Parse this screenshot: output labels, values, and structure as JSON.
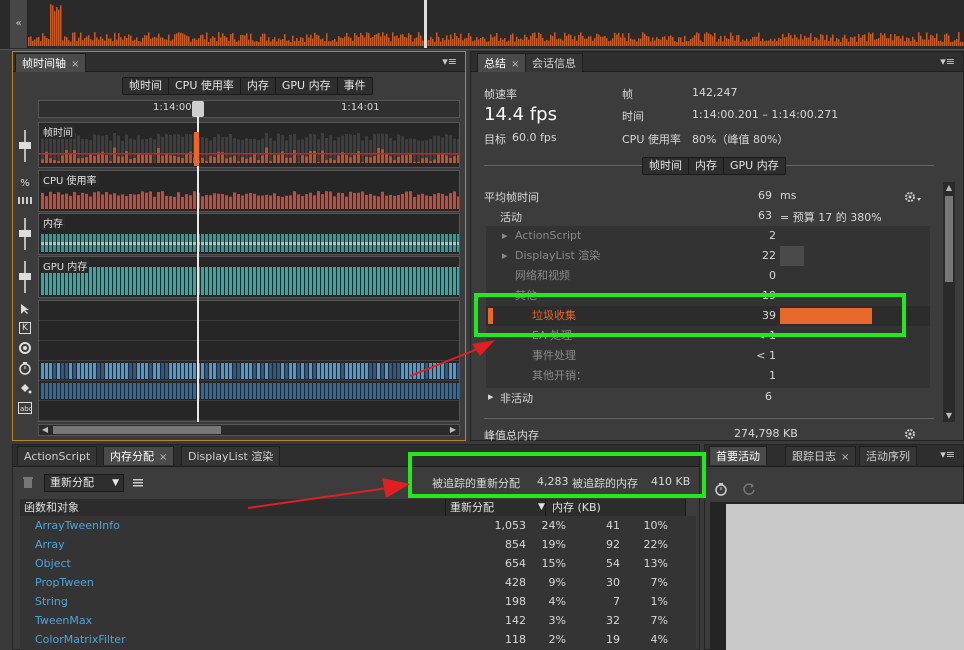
{
  "overview": {
    "collapse_glyph": "«"
  },
  "timeline_panel": {
    "tab_label": "帧时间轴",
    "tab_close": "×",
    "menu_glyph": "▾≡",
    "buttons": [
      "帧时间",
      "CPU 使用率",
      "内存",
      "GPU 内存",
      "事件"
    ],
    "time_marks": [
      "1:14:00",
      "1:14:01"
    ],
    "rows": [
      "帧时间",
      "CPU 使用率",
      "内存",
      "GPU 内存"
    ],
    "left_icons": [
      "%",
      "K"
    ]
  },
  "summary_panel": {
    "tabs": [
      {
        "label": "总结",
        "close": "×"
      },
      {
        "label": "会话信息"
      }
    ],
    "menu_glyph": "▾≡",
    "framerate_label": "帧速率",
    "framerate_value": "14.4 fps",
    "target_label": "目标",
    "target_value": "60.0 fps",
    "frame_label": "帧",
    "frame_value": "142,247",
    "time_label": "时间",
    "time_value": "1:14:00.201 – 1:14:00.271",
    "cpu_label": "CPU 使用率",
    "cpu_value": "80%（峰值 80%）",
    "sub_buttons": [
      "帧时间",
      "内存",
      "GPU 内存"
    ],
    "avg_label": "平均帧时间",
    "avg_value": "69",
    "avg_unit": "ms",
    "active_label": "活动",
    "active_value": "63",
    "active_note": "= 预算 17 的 380%",
    "tree": [
      {
        "name": "ActionScript",
        "value": "2",
        "dim": true,
        "arrow": true
      },
      {
        "name": "DisplayList 渲染",
        "value": "22",
        "dim": true,
        "arrow": true
      },
      {
        "name": "网络和视频",
        "value": "0",
        "dim": true
      },
      {
        "name": "其他",
        "value": "19",
        "dim": true
      },
      {
        "name": "垃圾收集",
        "value": "39",
        "highlight": true
      },
      {
        "name": "EA 处理",
        "value": "< 1",
        "dim": true
      },
      {
        "name": "事件处理",
        "value": "< 1",
        "dim": true
      },
      {
        "name": "其他开销：",
        "value": "1",
        "dim": true
      }
    ],
    "inactive_label": "非活动",
    "inactive_value": "6",
    "peak_label": "峰值总内存",
    "peak_value": "274,798 KB"
  },
  "alloc_panel": {
    "tabs": [
      {
        "label": "ActionScript"
      },
      {
        "label": "内存分配",
        "close": "×"
      },
      {
        "label": "DisplayList 渲染"
      }
    ],
    "dropdown_value": "重新分配",
    "tracked_label": "被追踪的重新分配",
    "tracked_value": "4,283",
    "tracked_mem_label": "被追踪的内存",
    "tracked_mem_value": "410 KB",
    "columns": [
      "函数和对象",
      "重新分配",
      "内存 (KB)"
    ],
    "rows": [
      {
        "name": "ArrayTweenInfo",
        "count": "1,053",
        "pct": "24%",
        "mem": "41",
        "mpct": "10%"
      },
      {
        "name": "Array",
        "count": "854",
        "pct": "19%",
        "mem": "92",
        "mpct": "22%"
      },
      {
        "name": "Object",
        "count": "654",
        "pct": "15%",
        "mem": "54",
        "mpct": "13%"
      },
      {
        "name": "PropTween",
        "count": "428",
        "pct": "9%",
        "mem": "30",
        "mpct": "7%"
      },
      {
        "name": "String",
        "count": "198",
        "pct": "4%",
        "mem": "7",
        "mpct": "1%"
      },
      {
        "name": "TweenMax",
        "count": "142",
        "pct": "3%",
        "mem": "32",
        "mpct": "7%"
      },
      {
        "name": "ColorMatrixFilter",
        "count": "118",
        "pct": "2%",
        "mem": "19",
        "mpct": "4%"
      }
    ]
  },
  "activity_panel": {
    "tabs": [
      {
        "label": "首要活动"
      },
      {
        "label": "跟踪日志",
        "close": "×"
      },
      {
        "label": "活动序列"
      }
    ],
    "menu_glyph": "▾≡"
  },
  "colors": {
    "highlight_green": "#22e81c",
    "arrow_red": "#e02020",
    "gc_orange": "#e8682a",
    "cpu_red": "#c24c3c",
    "mem_teal": "#2a9a9a",
    "event_blue": "#3a8ac8"
  }
}
